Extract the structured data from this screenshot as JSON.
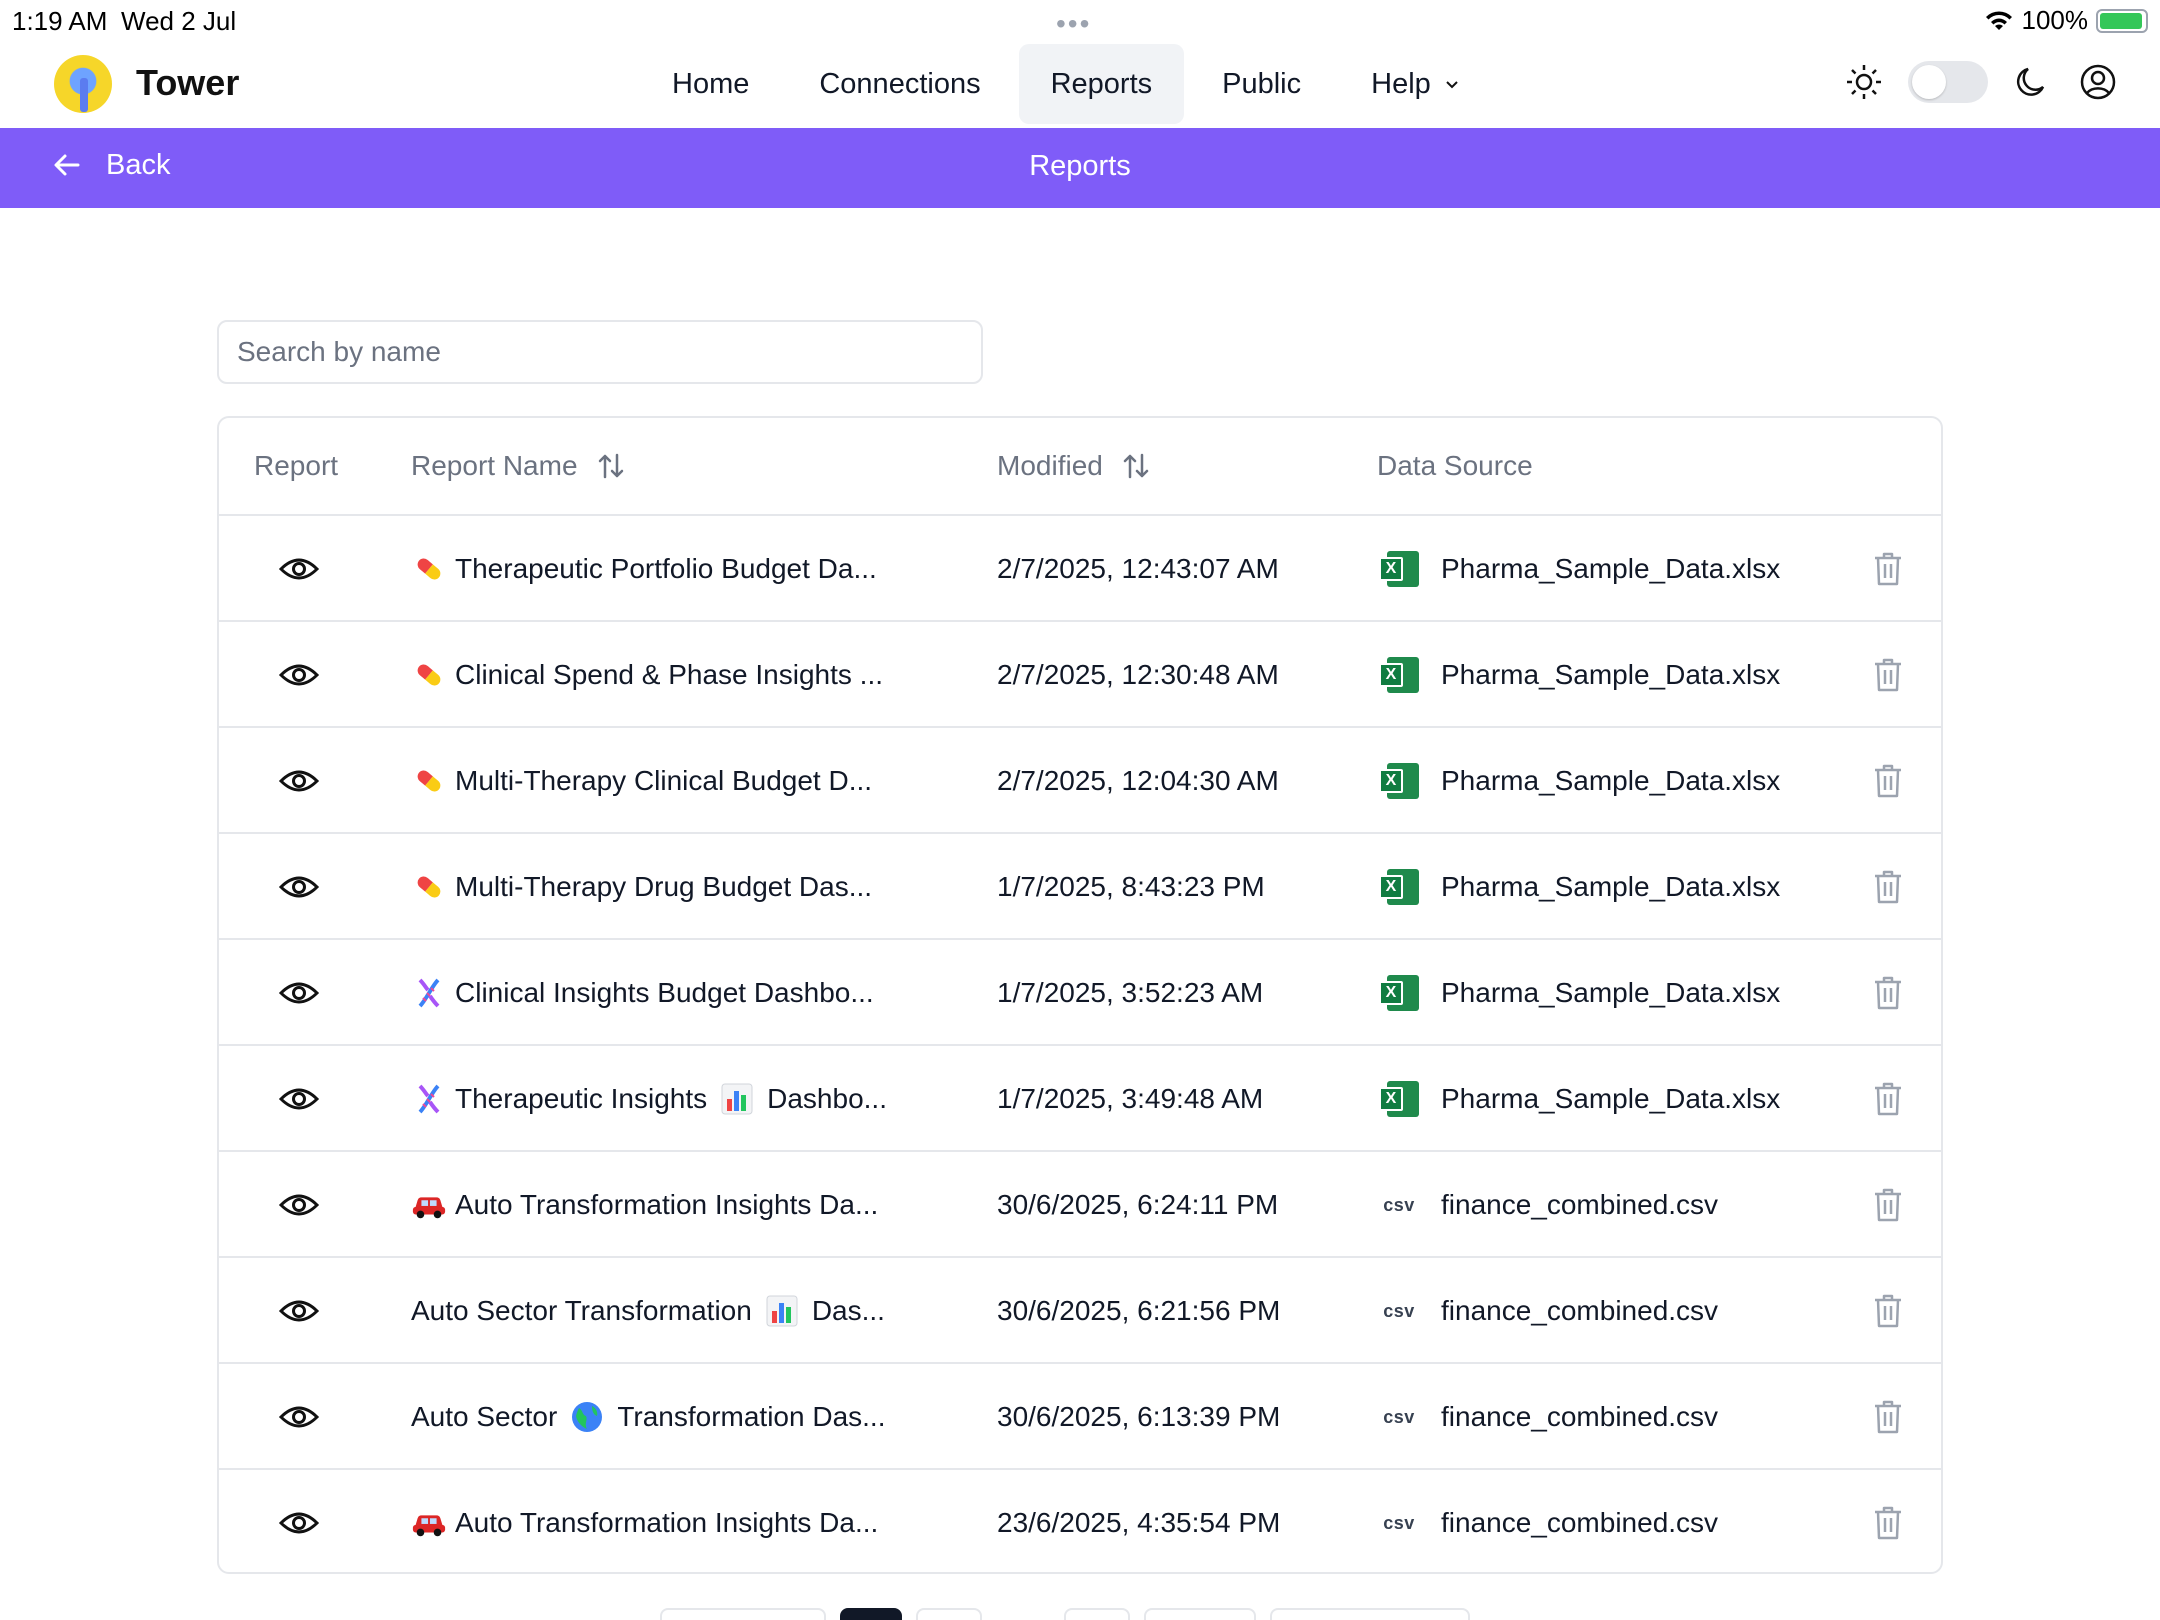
{
  "status_bar": {
    "time": "1:19 AM",
    "date": "Wed 2 Jul",
    "battery": "100%"
  },
  "app": {
    "name": "Tower"
  },
  "nav": {
    "items": [
      {
        "label": "Home",
        "active": false
      },
      {
        "label": "Connections",
        "active": false
      },
      {
        "label": "Reports",
        "active": true
      },
      {
        "label": "Public",
        "active": false
      }
    ],
    "help_label": "Help"
  },
  "subheader": {
    "back_label": "Back",
    "title": "Reports"
  },
  "search": {
    "placeholder": "Search by name",
    "value": ""
  },
  "table": {
    "headers": {
      "report": "Report",
      "name": "Report Name",
      "modified": "Modified",
      "source": "Data Source"
    },
    "rows": [
      {
        "emoji": "pill",
        "name": "Therapeutic Portfolio Budget Da...",
        "modified": "2/7/2025, 12:43:07 AM",
        "source_type": "excel",
        "source": "Pharma_Sample_Data.xlsx"
      },
      {
        "emoji": "pill",
        "name": "Clinical Spend & Phase Insights ...",
        "modified": "2/7/2025, 12:30:48 AM",
        "source_type": "excel",
        "source": "Pharma_Sample_Data.xlsx"
      },
      {
        "emoji": "pill",
        "name": "Multi-Therapy Clinical Budget D...",
        "modified": "2/7/2025, 12:04:30 AM",
        "source_type": "excel",
        "source": "Pharma_Sample_Data.xlsx"
      },
      {
        "emoji": "pill",
        "name": "Multi-Therapy Drug Budget Das...",
        "modified": "1/7/2025, 8:43:23 PM",
        "source_type": "excel",
        "source": "Pharma_Sample_Data.xlsx"
      },
      {
        "emoji": "dna",
        "name": "Clinical Insights Budget Dashbo...",
        "modified": "1/7/2025, 3:52:23 AM",
        "source_type": "excel",
        "source": "Pharma_Sample_Data.xlsx"
      },
      {
        "emoji": "dna",
        "name": "Therapeutic Insights",
        "name_emoji2": "chart",
        "name_rest": "Dashbo...",
        "modified": "1/7/2025, 3:49:48 AM",
        "source_type": "excel",
        "source": "Pharma_Sample_Data.xlsx"
      },
      {
        "emoji": "car",
        "name": "Auto Transformation Insights Da...",
        "modified": "30/6/2025, 6:24:11 PM",
        "source_type": "csv",
        "source": "finance_combined.csv"
      },
      {
        "emoji": "",
        "name": "Auto Sector Transformation",
        "name_emoji2": "chart",
        "name_rest": "Das...",
        "modified": "30/6/2025, 6:21:56 PM",
        "source_type": "csv",
        "source": "finance_combined.csv"
      },
      {
        "emoji": "",
        "name": "Auto Sector",
        "name_emoji2": "globe",
        "name_rest": "Transformation Das...",
        "modified": "30/6/2025, 6:13:39 PM",
        "source_type": "csv",
        "source": "finance_combined.csv"
      },
      {
        "emoji": "car",
        "name": "Auto Transformation Insights Da...",
        "modified": "23/6/2025, 4:35:54 PM",
        "source_type": "csv",
        "source": "finance_combined.csv"
      }
    ],
    "csv_badge": "csv"
  },
  "colors": {
    "accent": "#7f5cf8",
    "border": "#e5e7eb",
    "muted": "#6b7280",
    "excel": "#107c41"
  },
  "icons": [
    "eye-icon",
    "trash-icon",
    "sort-icon",
    "sun-icon",
    "moon-icon",
    "user-circle-icon",
    "arrow-left-icon",
    "chevron-down-icon"
  ]
}
